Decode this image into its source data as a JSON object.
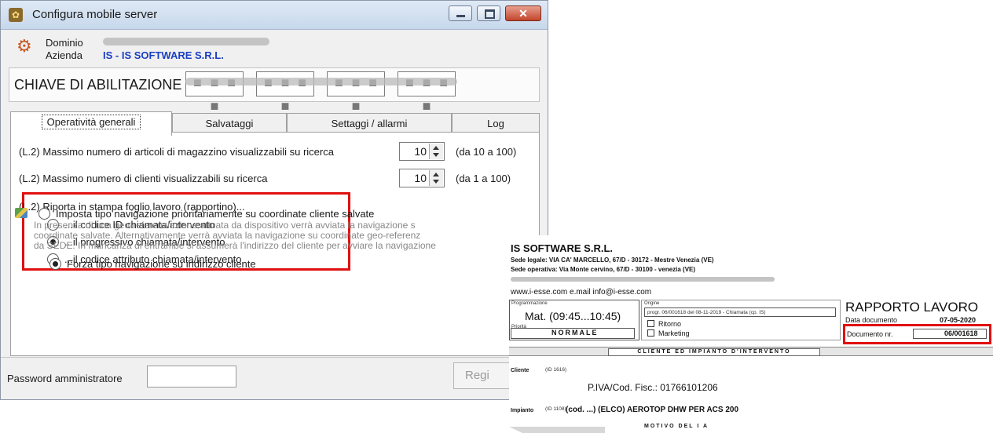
{
  "window": {
    "title": "Configura mobile server",
    "close_glyph": "✕"
  },
  "header": {
    "dominio_label": "Dominio",
    "azienda_label": "Azienda",
    "azienda_value": "IS - IS SOFTWARE S.R.L."
  },
  "license": {
    "title": "CHIAVE DI ABILITAZIONE"
  },
  "tabs": [
    {
      "label": "Operatività generali",
      "active": true
    },
    {
      "label": "Salvataggi"
    },
    {
      "label": "Settaggi / allarmi"
    },
    {
      "label": "Log"
    }
  ],
  "settings": {
    "max_articoli_label": "(L.2) Massimo numero di articoli di magazzino visualizzabili su ricerca",
    "max_articoli_value": "10",
    "max_articoli_range": "(da 10 a 100)",
    "max_clienti_label": "(L.2) Massimo numero di clienti visualizzabili su ricerca",
    "max_clienti_value": "10",
    "max_clienti_range": "(da  1 a 100)",
    "stampa_label": "(L.2) Riporta in stampa foglio lavoro (rapportino)...",
    "stampa_options": [
      {
        "label": "...il codice ID chiamata/intervento",
        "selected": false
      },
      {
        "label": "...il progressivo chiamata/intervento",
        "selected": true
      },
      {
        "label": "...il codice attributo chiamata/intervento",
        "selected": false
      }
    ],
    "nav_coord_label": "Imposta tipo navigazione prioritariamente su coordinate cliente salvate",
    "nav_note": [
      "In presenza di una geo-referenziazione attuata da dispositivo verrà avviata la navigazione s",
      "coordinate salvate. Alternativamente verrà avviata la navigazione su coordinate geo-referenz",
      "da SEDE. In mancanza di entrambe si assumerà l'indirizzo del cliente per avviare la navigazione"
    ],
    "nav_force_label": "Forza tipo navigazione su indirizzo cliente"
  },
  "footer": {
    "password_label": "Password amministratore",
    "password_value": "",
    "register_button": "Regi"
  },
  "report": {
    "company": "IS SOFTWARE S.R.L.",
    "sede_legale": "Sede legale: VIA CA' MARCELLO, 67/D - 30172 - Mestre  Venezia (VE)",
    "sede_operativa": "Sede operativa: Via Monte cervino, 67/D - 30100 - venezia (VE)",
    "web": "www.i-esse.com  e.mail  info@i-esse.com",
    "programmazione_label": "Programmazione",
    "programmazione_value": "Mat. (09:45...10:45)",
    "priorita_label": "Priorità",
    "priorita_value": "NORMALE",
    "origine_label": "Origine",
    "origine_value": "progr. 06/001618 del 08-11-2019 - Chiamata (cp. IS)",
    "ritorno": "Ritorno",
    "marketing": "Marketing",
    "title": "RAPPORTO LAVORO",
    "data_documento_label": "Data documento",
    "data_documento_value": "07-05-2020",
    "documento_nr_label": "Documento nr.",
    "documento_nr_value": "06/001618",
    "section_title": "CLIENTE ED IMPIANTO D'INTERVENTO",
    "cliente_label": "Cliente",
    "cliente_id": "(ID 1616)",
    "piva": "P.IVA/Cod. Fisc.: 01766101206",
    "impianto_label": "Impianto",
    "impianto_id": "(ID 1108)",
    "impianto_value": "(cod. ...) (ELCO)  AEROTOP DHW PER ACS 200",
    "motivo": "MOTIVO DEL I  A"
  },
  "colors": {
    "highlight_red": "#e01010",
    "azienda_blue": "#1a3ec4",
    "title_bar": "#c7d8ec"
  }
}
